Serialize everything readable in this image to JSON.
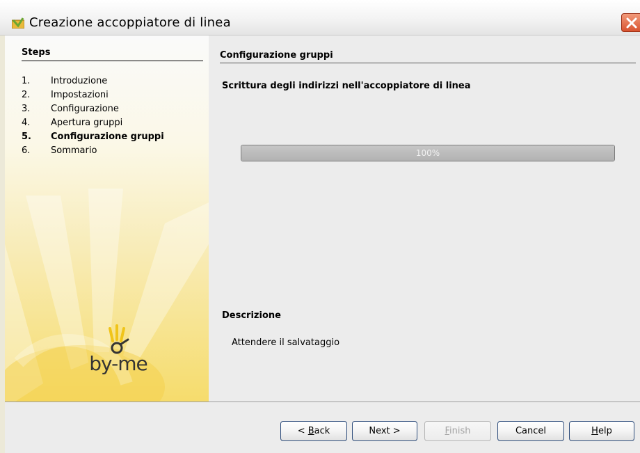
{
  "window": {
    "title": "Creazione accoppiatore di linea",
    "title_icon": "wizard-folder-icon",
    "close_icon": "close-icon"
  },
  "steps": {
    "title": "Steps",
    "items": [
      {
        "num": "1.",
        "label": "Introduzione"
      },
      {
        "num": "2.",
        "label": "Impostazioni"
      },
      {
        "num": "3.",
        "label": "Configurazione"
      },
      {
        "num": "4.",
        "label": "Apertura gruppi"
      },
      {
        "num": "5.",
        "label": "Configurazione gruppi"
      },
      {
        "num": "6.",
        "label": "Sommario"
      }
    ],
    "current_index": 4
  },
  "logo": {
    "text": "by-me"
  },
  "main": {
    "section_title": "Configurazione gruppi",
    "write_label": "Scrittura degli indirizzi nell'accoppiatore di linea",
    "progress": {
      "value": 1.0,
      "text": "100%"
    },
    "description_title": "Descrizione",
    "description_text": "Attendere il salvataggio"
  },
  "buttons": {
    "back": {
      "pre": "< ",
      "mn": "B",
      "post": "ack"
    },
    "next": {
      "label": "Next >"
    },
    "finish": {
      "pre": "",
      "mn": "F",
      "post": "inish",
      "disabled": true
    },
    "cancel": {
      "label": "Cancel"
    },
    "help": {
      "pre": "",
      "mn": "H",
      "post": "elp"
    }
  },
  "colors": {
    "accent_border": "#2c4b7a",
    "panel_yellow": "#f6dc6c",
    "close_red": "#d8532f"
  }
}
